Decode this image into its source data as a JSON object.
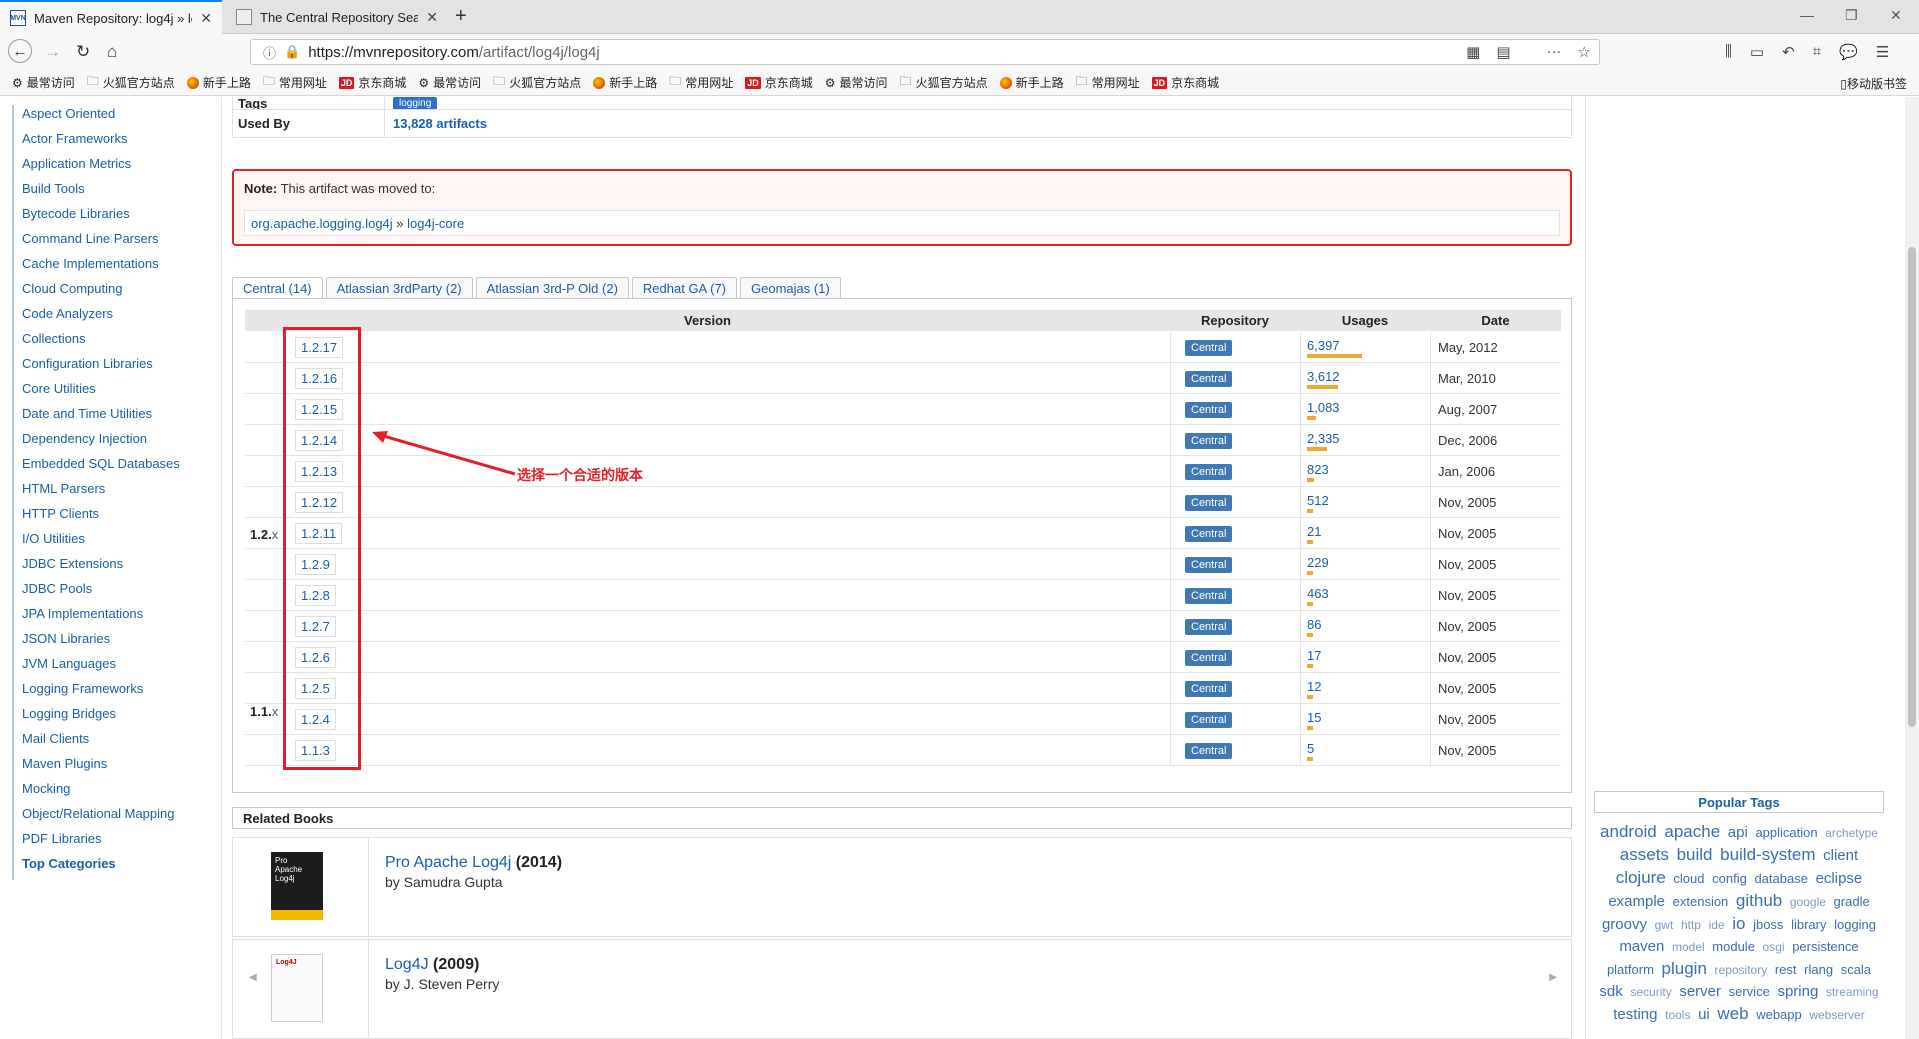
{
  "browser": {
    "tabs": [
      {
        "title": "Maven Repository: log4j » lo",
        "favicon": "MVN"
      },
      {
        "title": "The Central Repository Sear",
        "favicon": "doc"
      }
    ],
    "url_host": "https://mvnrepository.com",
    "url_path": "/artifact/log4j/log4j",
    "bookmarks": [
      {
        "label": "最常访问",
        "icon": "gear"
      },
      {
        "label": "火狐官方站点",
        "icon": "folder"
      },
      {
        "label": "新手上路",
        "icon": "firefox"
      },
      {
        "label": "常用网址",
        "icon": "folder"
      },
      {
        "label": "京东商城",
        "icon": "jd"
      },
      {
        "label": "最常访问",
        "icon": "gear"
      },
      {
        "label": "火狐官方站点",
        "icon": "folder"
      },
      {
        "label": "新手上路",
        "icon": "firefox"
      },
      {
        "label": "常用网址",
        "icon": "folder"
      },
      {
        "label": "京东商城",
        "icon": "jd"
      },
      {
        "label": "最常访问",
        "icon": "gear"
      },
      {
        "label": "火狐官方站点",
        "icon": "folder"
      },
      {
        "label": "新手上路",
        "icon": "firefox"
      },
      {
        "label": "常用网址",
        "icon": "folder"
      },
      {
        "label": "京东商城",
        "icon": "jd"
      }
    ],
    "mobile_bookmarks": "移动版书签"
  },
  "sidebar": {
    "items": [
      "Aspect Oriented",
      "Actor Frameworks",
      "Application Metrics",
      "Build Tools",
      "Bytecode Libraries",
      "Command Line Parsers",
      "Cache Implementations",
      "Cloud Computing",
      "Code Analyzers",
      "Collections",
      "Configuration Libraries",
      "Core Utilities",
      "Date and Time Utilities",
      "Dependency Injection",
      "Embedded SQL Databases",
      "HTML Parsers",
      "HTTP Clients",
      "I/O Utilities",
      "JDBC Extensions",
      "JDBC Pools",
      "JPA Implementations",
      "JSON Libraries",
      "JVM Languages",
      "Logging Frameworks",
      "Logging Bridges",
      "Mail Clients",
      "Maven Plugins",
      "Mocking",
      "Object/Relational Mapping",
      "PDF Libraries"
    ],
    "top_categories": "Top Categories"
  },
  "info": {
    "tags_label": "Tags",
    "tag": "logging",
    "used_by_label": "Used By",
    "used_by_value": "13,828 artifacts"
  },
  "note": {
    "label": "Note:",
    "text": " This artifact was moved to:",
    "group": "org.apache.logging.log4j",
    "sep": " » ",
    "artifact": "log4j-core"
  },
  "repo_tabs": [
    "Central (14)",
    "Atlassian 3rdParty (2)",
    "Atlassian 3rd-P Old (2)",
    "Redhat GA (7)",
    "Geomajas (1)"
  ],
  "table": {
    "headers": {
      "version": "Version",
      "repository": "Repository",
      "usages": "Usages",
      "date": "Date"
    },
    "groups": [
      {
        "label": "1.2.",
        "suffix": "x"
      },
      {
        "label": "1.1.",
        "suffix": "x"
      }
    ],
    "rows": [
      {
        "version": "1.2.17",
        "repo": "Central",
        "usages": "6,397",
        "usage_fraction": 1.0,
        "date": "May, 2012"
      },
      {
        "version": "1.2.16",
        "repo": "Central",
        "usages": "3,612",
        "usage_fraction": 0.56,
        "date": "Mar, 2010"
      },
      {
        "version": "1.2.15",
        "repo": "Central",
        "usages": "1,083",
        "usage_fraction": 0.17,
        "date": "Aug, 2007"
      },
      {
        "version": "1.2.14",
        "repo": "Central",
        "usages": "2,335",
        "usage_fraction": 0.36,
        "date": "Dec, 2006"
      },
      {
        "version": "1.2.13",
        "repo": "Central",
        "usages": "823",
        "usage_fraction": 0.13,
        "date": "Jan, 2006"
      },
      {
        "version": "1.2.12",
        "repo": "Central",
        "usages": "512",
        "usage_fraction": 0.08,
        "date": "Nov, 2005"
      },
      {
        "version": "1.2.11",
        "repo": "Central",
        "usages": "21",
        "usage_fraction": 0.01,
        "date": "Nov, 2005"
      },
      {
        "version": "1.2.9",
        "repo": "Central",
        "usages": "229",
        "usage_fraction": 0.04,
        "date": "Nov, 2005"
      },
      {
        "version": "1.2.8",
        "repo": "Central",
        "usages": "463",
        "usage_fraction": 0.07,
        "date": "Nov, 2005"
      },
      {
        "version": "1.2.7",
        "repo": "Central",
        "usages": "86",
        "usage_fraction": 0.02,
        "date": "Nov, 2005"
      },
      {
        "version": "1.2.6",
        "repo": "Central",
        "usages": "17",
        "usage_fraction": 0.01,
        "date": "Nov, 2005"
      },
      {
        "version": "1.2.5",
        "repo": "Central",
        "usages": "12",
        "usage_fraction": 0.01,
        "date": "Nov, 2005"
      },
      {
        "version": "1.2.4",
        "repo": "Central",
        "usages": "15",
        "usage_fraction": 0.01,
        "date": "Nov, 2005"
      },
      {
        "version": "1.1.3",
        "repo": "Central",
        "usages": "5",
        "usage_fraction": 0.01,
        "date": "Nov, 2005"
      }
    ]
  },
  "annotation": "选择一个合适的版本",
  "related_books": {
    "title": "Related Books",
    "books": [
      {
        "title": "Pro Apache Log4j",
        "year": "(2014)",
        "author": "by Samudra Gupta",
        "cover_text": "Pro Apache Log4j"
      },
      {
        "title": "Log4J",
        "year": "(2009)",
        "author": "by J. Steven Perry",
        "cover_text": "Log4J"
      }
    ]
  },
  "popular_tags": {
    "title": "Popular Tags",
    "tags": [
      {
        "t": "android",
        "s": 3
      },
      {
        "t": "apache",
        "s": 3
      },
      {
        "t": "api",
        "s": 2
      },
      {
        "t": "application",
        "s": 1
      },
      {
        "t": "archetype",
        "s": 0
      },
      {
        "t": "assets",
        "s": 3
      },
      {
        "t": "build",
        "s": 3
      },
      {
        "t": "build-system",
        "s": 3
      },
      {
        "t": "client",
        "s": 2
      },
      {
        "t": "clojure",
        "s": 3
      },
      {
        "t": "cloud",
        "s": 1
      },
      {
        "t": "config",
        "s": 1
      },
      {
        "t": "database",
        "s": 1
      },
      {
        "t": "eclipse",
        "s": 2
      },
      {
        "t": "example",
        "s": 2
      },
      {
        "t": "extension",
        "s": 1
      },
      {
        "t": "github",
        "s": 3
      },
      {
        "t": "google",
        "s": 0
      },
      {
        "t": "gradle",
        "s": 1
      },
      {
        "t": "groovy",
        "s": 2
      },
      {
        "t": "gwt",
        "s": 0
      },
      {
        "t": "http",
        "s": 0
      },
      {
        "t": "ide",
        "s": 0
      },
      {
        "t": "io",
        "s": 3
      },
      {
        "t": "jboss",
        "s": 1
      },
      {
        "t": "library",
        "s": 1
      },
      {
        "t": "logging",
        "s": 1
      },
      {
        "t": "maven",
        "s": 2
      },
      {
        "t": "model",
        "s": 0
      },
      {
        "t": "module",
        "s": 1
      },
      {
        "t": "osgi",
        "s": 0
      },
      {
        "t": "persistence",
        "s": 1
      },
      {
        "t": "platform",
        "s": 1
      },
      {
        "t": "plugin",
        "s": 3
      },
      {
        "t": "repository",
        "s": 0
      },
      {
        "t": "rest",
        "s": 1
      },
      {
        "t": "rlang",
        "s": 1
      },
      {
        "t": "scala",
        "s": 1
      },
      {
        "t": "sdk",
        "s": 2
      },
      {
        "t": "security",
        "s": 0
      },
      {
        "t": "server",
        "s": 2
      },
      {
        "t": "service",
        "s": 1
      },
      {
        "t": "spring",
        "s": 2
      },
      {
        "t": "streaming",
        "s": 0
      },
      {
        "t": "testing",
        "s": 2
      },
      {
        "t": "tools",
        "s": 0
      },
      {
        "t": "ui",
        "s": 2
      },
      {
        "t": "web",
        "s": 3
      },
      {
        "t": "webapp",
        "s": 1
      },
      {
        "t": "webserver",
        "s": 0
      }
    ]
  },
  "colors": {
    "accent": "#1a5fa8",
    "note_border": "#d9262b",
    "annotation": "#e21f26",
    "central_badge": "#3f78b3",
    "usage_bar": "#f0a830"
  }
}
